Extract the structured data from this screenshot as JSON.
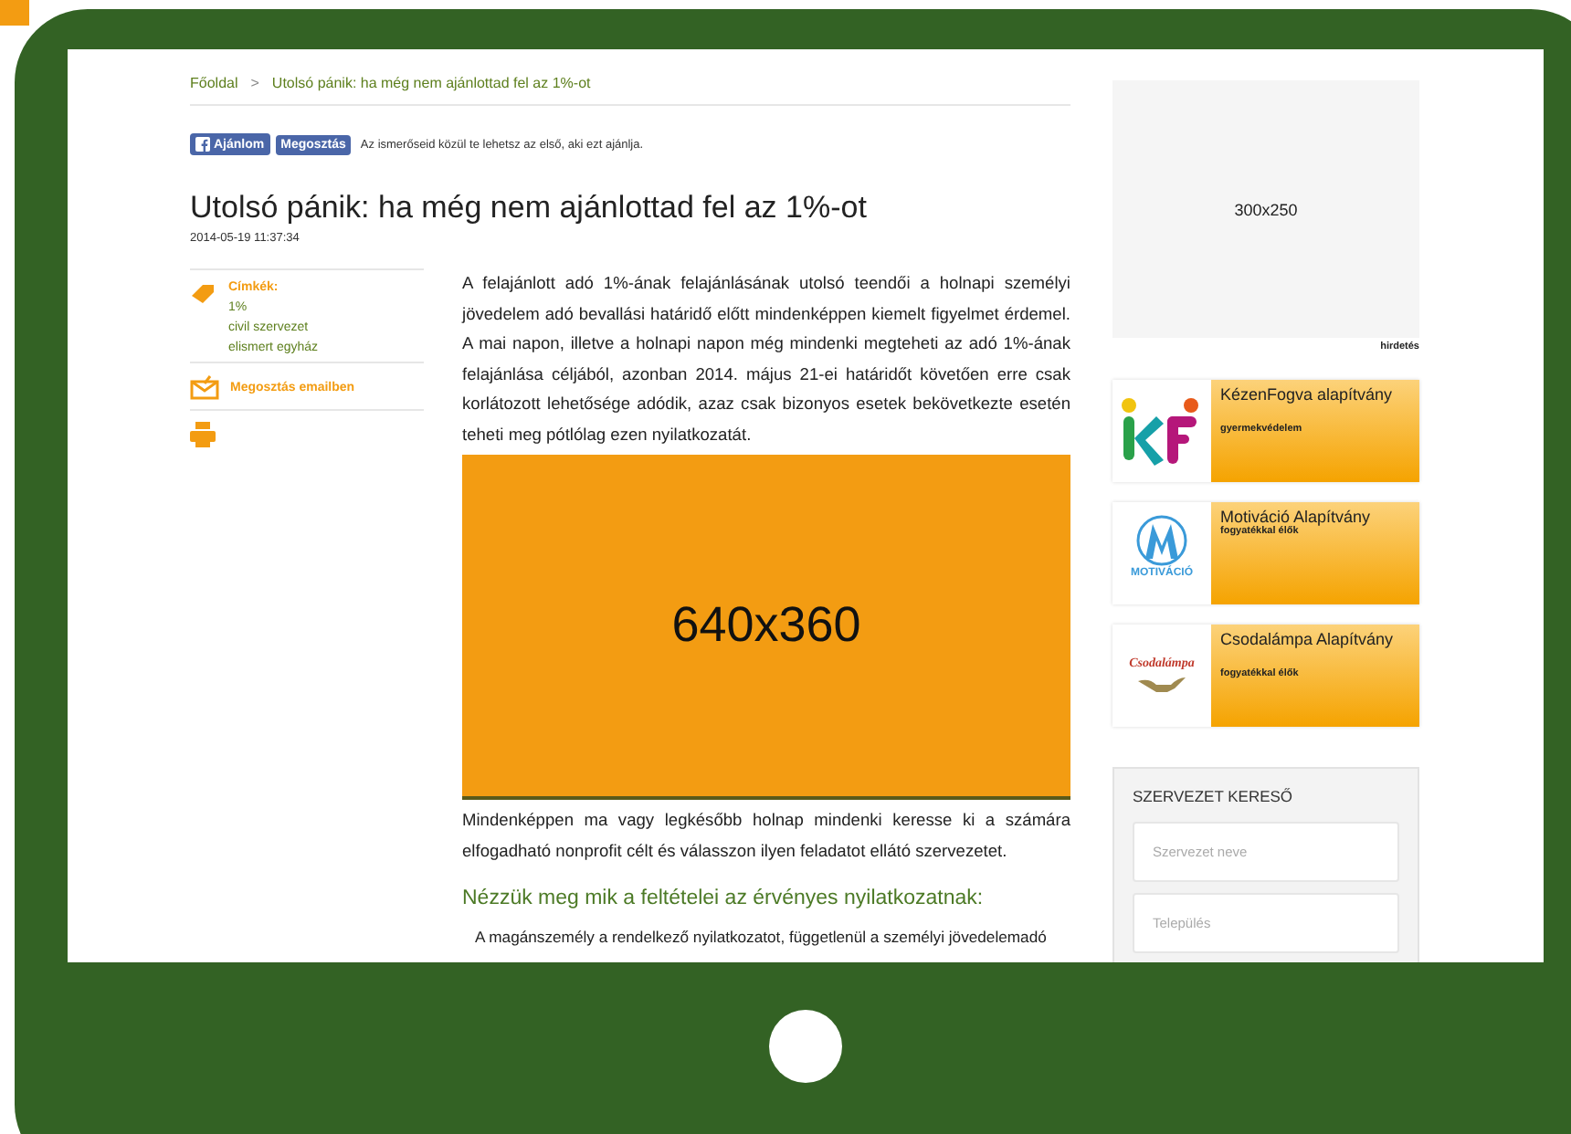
{
  "breadcrumb": [
    {
      "label": "Főoldal"
    },
    {
      "label": "Utolsó pánik: ha még nem ajánlottad fel az 1%-ot"
    }
  ],
  "breadcrumb_separator": ">",
  "social": {
    "like_button": "Ajánlom",
    "share_button": "Megosztás",
    "note": "Az ismerőseid közül te lehetsz az első, aki ezt ajánlja."
  },
  "article": {
    "title": "Utolsó pánik: ha még nem ajánlottad fel az 1%-ot",
    "date": "2014-05-19 11:37:34",
    "intro": "A felajánlott adó 1%-ának felajánlásának utolsó teendői a holnapi személyi jövedelem adó bevallási határidő előtt mindenképpen kiemelt figyelmet érdemel. A mai napon, illetve a holnapi napon még mindenki megteheti az adó 1%-ának felajánlása céljából, azonban 2014. május 21-ei határidőt követően erre csak korlátozott lehetősége adódik, azaz csak bizonyos esetek bekövetkezte esetén teheti meg pótlólag ezen nyilatkozatát.",
    "image_placeholder": "640x360",
    "after": "Mindenképpen ma vagy legkésőbb holnap mindenki keresse ki a számára elfogadható nonprofit célt és válasszon ilyen feladatot ellátó szervezetet.",
    "subheading": "Nézzük meg mik a feltételei az érvényes nyilatkozatnak:",
    "cut_line": "A magánszemély a rendelkező nyilatkozatot, függetlenül a személyi jövedelemadó"
  },
  "tags": {
    "label": "Címkék:",
    "items": [
      "1%",
      "civil szervezet",
      "elismert egyház"
    ]
  },
  "email_share": "Megosztás emailben",
  "ad": {
    "size": "300x250",
    "label": "hirdetés"
  },
  "organizations": [
    {
      "name": "KézenFogva alapítvány",
      "subtitle": "gyermekvédelem",
      "kind": "kf"
    },
    {
      "name": "Motiváció Alapítvány",
      "subtitle": "fogyatékkal élők",
      "kind": "motivacio",
      "logo_text": "MOTIVÁCIÓ"
    },
    {
      "name": "Csodalámpa Alapítvány",
      "subtitle": "fogyatékkal élők",
      "kind": "lamp",
      "logo_text": "Csodalámpa"
    }
  ],
  "search": {
    "title": "SZERVEZET KERESŐ",
    "fields": [
      {
        "placeholder": "Szervezet neve"
      },
      {
        "placeholder": "Település"
      }
    ]
  }
}
